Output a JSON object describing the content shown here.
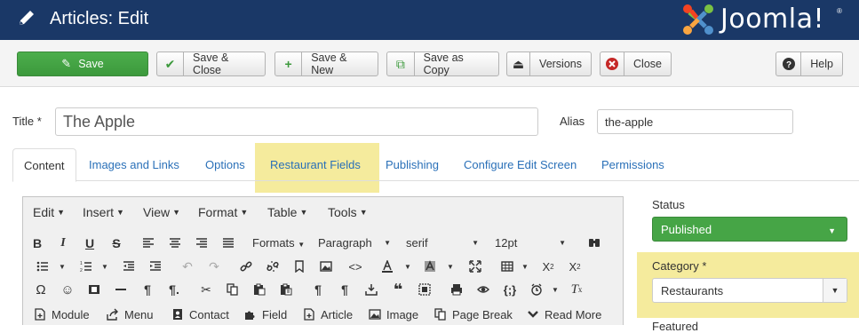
{
  "header": {
    "title": "Articles: Edit",
    "logo_text": "Joomla!",
    "logo_mark": "®"
  },
  "toolbar": {
    "save": "Save",
    "save_close": "Save & Close",
    "save_new": "Save & New",
    "save_copy": "Save as Copy",
    "versions": "Versions",
    "close": "Close",
    "help": "Help"
  },
  "form": {
    "title_label": "Title *",
    "title_value": "The Apple",
    "alias_label": "Alias",
    "alias_value": "the-apple"
  },
  "tabs": [
    {
      "label": "Content"
    },
    {
      "label": "Images and Links"
    },
    {
      "label": "Options"
    },
    {
      "label": "Restaurant Fields"
    },
    {
      "label": "Publishing"
    },
    {
      "label": "Configure Edit Screen"
    },
    {
      "label": "Permissions"
    }
  ],
  "editor": {
    "menus": [
      "Edit",
      "Insert",
      "View",
      "Format",
      "Table",
      "Tools"
    ],
    "formats_label": "Formats",
    "paragraph_label": "Paragraph",
    "font_label": "serif",
    "size_label": "12pt",
    "insert_buttons": [
      "Module",
      "Menu",
      "Contact",
      "Field",
      "Article",
      "Image",
      "Page Break",
      "Read More"
    ]
  },
  "sidebar": {
    "status_label": "Status",
    "status_value": "Published",
    "category_label": "Category *",
    "category_value": "Restaurants",
    "featured_label": "Featured"
  },
  "colors": {
    "header_bg": "#1a3867",
    "save_green": "#46a546",
    "highlight_yellow": "#f5eb9d",
    "link_blue": "#2a70b8"
  }
}
